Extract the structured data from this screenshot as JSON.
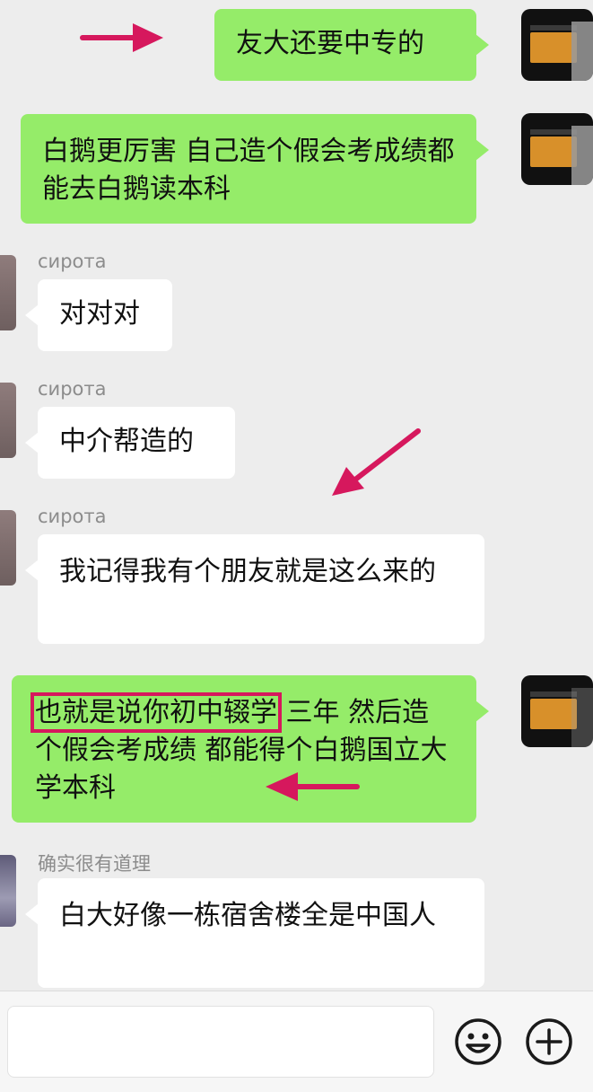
{
  "messages": [
    {
      "side": "self",
      "text": "友大还要中专的"
    },
    {
      "side": "self",
      "text": "白鹅更厉害 自己造个假会考成绩都能去白鹅读本科"
    },
    {
      "side": "other",
      "sender": "сирота",
      "text": "对对对"
    },
    {
      "side": "other",
      "sender": "сирота",
      "text": "中介帮造的"
    },
    {
      "side": "other",
      "sender": "сирота",
      "text": "我记得我有个朋友就是这么来的"
    },
    {
      "side": "self",
      "highlight": "也就是说你初中辍学",
      "text": " 三年 然后造个假会考成绩 都能得个白鹅国立大学本科"
    },
    {
      "side": "other",
      "sender": "确实很有道理",
      "text": "白大好像一栋宿舍楼全是中国人"
    }
  ],
  "input": {
    "value": ""
  },
  "icons": {
    "emoji": "smiley-face-icon",
    "more": "plus-circle-icon"
  },
  "colors": {
    "my_bubble": "#95ec69",
    "their_bubble": "#ffffff",
    "annotation": "#d6185d",
    "background": "#ededed"
  }
}
